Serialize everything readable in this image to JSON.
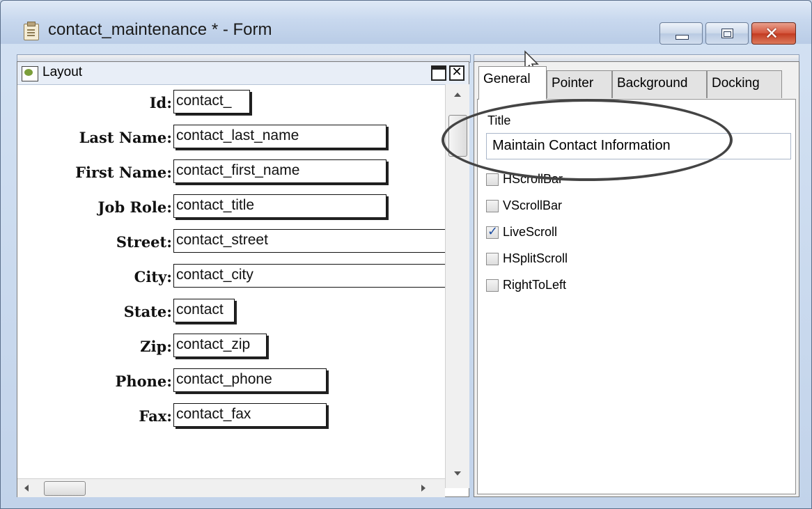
{
  "window": {
    "title": "contact_maintenance * - Form"
  },
  "layout_panel": {
    "title": "Layout",
    "fields": [
      {
        "label": "Id:",
        "value": "contact_"
      },
      {
        "label": "Last Name:",
        "value": "contact_last_name"
      },
      {
        "label": "First Name:",
        "value": "contact_first_name"
      },
      {
        "label": "Job Role:",
        "value": "contact_title"
      },
      {
        "label": "Street:",
        "value": "contact_street"
      },
      {
        "label": "City:",
        "value": "contact_city"
      },
      {
        "label": "State:",
        "value": "contact"
      },
      {
        "label": "Zip:",
        "value": "contact_zip"
      },
      {
        "label": "Phone:",
        "value": "contact_phone"
      },
      {
        "label": "Fax:",
        "value": "contact_fax"
      }
    ]
  },
  "properties": {
    "tabs": [
      "General",
      "Pointer",
      "Background",
      "Docking"
    ],
    "active_tab": "General",
    "title_label": "Title",
    "title_value": "Maintain Contact Information",
    "checkboxes": [
      {
        "label": "HScrollBar",
        "checked": false
      },
      {
        "label": "VScrollBar",
        "checked": false
      },
      {
        "label": "LiveScroll",
        "checked": true
      },
      {
        "label": "HSplitScroll",
        "checked": false
      },
      {
        "label": "RightToLeft",
        "checked": false
      }
    ]
  }
}
